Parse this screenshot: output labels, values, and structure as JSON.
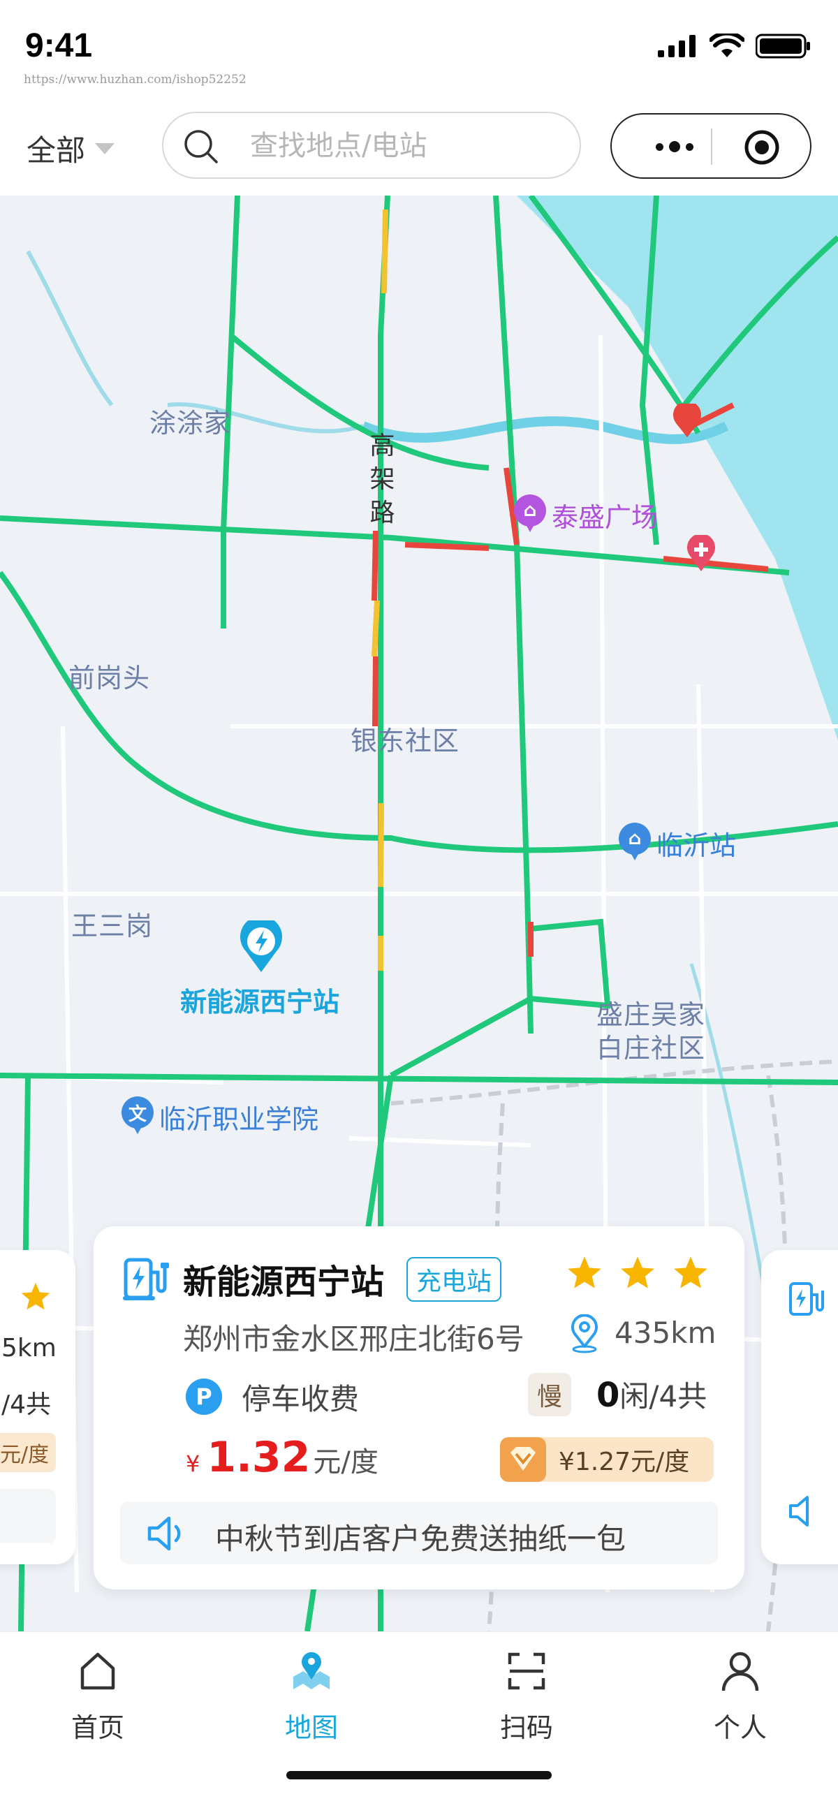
{
  "status_bar": {
    "time": "9:41",
    "watermark": "https://www.huzhan.com/ishop52252"
  },
  "top_bar": {
    "filter_label": "全部",
    "search_placeholder": "查找地点/电站",
    "capsule": {
      "more_icon": "more-dots-icon",
      "target_icon": "target-circle-icon"
    }
  },
  "map": {
    "places": {
      "tutujia": "涂涂家",
      "gaojia_road": "高架路",
      "qiangangtou": "前岗头",
      "yindong": "银东社区",
      "wangsangang": "王三岗",
      "shengzhuang1": "盛庄吴家",
      "shengzhuang2": "白庄社区"
    },
    "pois": {
      "taisheng": "泰盛广场",
      "linyi_station": "临沂站",
      "linyi_college": "临沂职业学院"
    },
    "selected_station_label": "新能源西宁站"
  },
  "side_left": {
    "distance": "5km",
    "availability": "/4共",
    "price": "元/度"
  },
  "station_card": {
    "name": "新能源西宁站",
    "type_badge": "充电站",
    "rating": 3,
    "address": "郑州市金水区邢庄北街6号",
    "distance": "435km",
    "parking": "停车收费",
    "speed_badge": "慢",
    "available": "0",
    "availability_suffix": "闲/4共",
    "currency": "¥",
    "price": "1.32",
    "price_unit": "元/度",
    "member_price": "¥1.27元/度",
    "notice": "中秋节到店客户免费送抽纸一包"
  },
  "bottom_nav": [
    {
      "label": "首页",
      "icon": "home-icon",
      "active": false
    },
    {
      "label": "地图",
      "icon": "map-pin-icon",
      "active": true
    },
    {
      "label": "扫码",
      "icon": "scan-icon",
      "active": false
    },
    {
      "label": "个人",
      "icon": "person-icon",
      "active": false
    }
  ],
  "colors": {
    "accent": "#1aa6dc",
    "price_red": "#e51d1d",
    "star": "#f7b500",
    "road_green": "#1fc87a",
    "road_red": "#e8453c",
    "road_yellow": "#f2c230"
  }
}
